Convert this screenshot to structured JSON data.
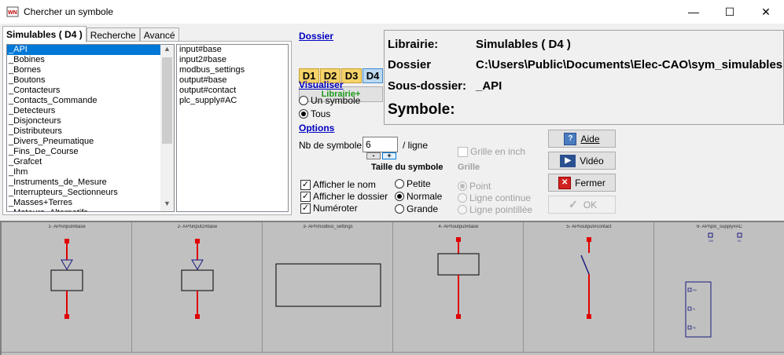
{
  "window": {
    "title": "Chercher un symbole",
    "minimize_glyph": "—",
    "maximize_glyph": "☐",
    "close_glyph": "✕"
  },
  "tabs": [
    "Simulables ( D4 )",
    "Recherche",
    "Avancé"
  ],
  "categories": {
    "selected": "_API",
    "items": [
      "_API",
      "_Bobines",
      "_Bornes",
      "_Boutons",
      "_Contacteurs",
      "_Contacts_Commande",
      "_Detecteurs",
      "_Disjoncteurs",
      "_Distributeurs",
      "_Divers_Pneumatique",
      "_Fins_De_Course",
      "_Grafcet",
      "_Ihm",
      "_Instruments_de_Mesure",
      "_Interrupteurs_Sectionneurs",
      "_Masses+Terres",
      "_Moteurs_Alternatifs"
    ]
  },
  "symbols": [
    "input#base",
    "input2#base",
    "modbus_settings",
    "output#base",
    "output#contact",
    "plc_supply#AC"
  ],
  "dossier": {
    "heading": "Dossier",
    "buttons": [
      "D1",
      "D2",
      "D3",
      "D4"
    ],
    "active": "D4",
    "library_button": "Librairie+"
  },
  "visualiser": {
    "heading": "Visualiser",
    "options": [
      "Un symbole",
      "Tous"
    ],
    "selected": "Tous"
  },
  "options": {
    "heading": "Options",
    "count_label": "Nb de symbole :",
    "count_value": "6",
    "per_line": "/ ligne",
    "minus": "-",
    "plus": "+",
    "checkboxes": [
      {
        "label": "Afficher le nom",
        "checked": true
      },
      {
        "label": "Afficher le dossier",
        "checked": true
      },
      {
        "label": "Numéroter",
        "checked": true
      }
    ],
    "size_heading": "Taille du symbole",
    "sizes": [
      "Petite",
      "Normale",
      "Grande"
    ],
    "size_selected": "Normale"
  },
  "grille": {
    "inch_label": "Grille en inch",
    "heading": "Grille",
    "options": [
      "Point",
      "Ligne continue",
      "Ligne pointillée"
    ],
    "selected": "Point"
  },
  "info": {
    "librairie_label": "Librairie:",
    "librairie_value": "Simulables ( D4 )",
    "dossier_label": "Dossier",
    "dossier_value": "C:\\Users\\Public\\Documents\\Elec-CAO\\sym_simulables",
    "sous_dossier_label": "Sous-dossier:",
    "sous_dossier_value": "_API",
    "symbole_label": "Symbole:"
  },
  "buttons": {
    "aide": "Aide",
    "video": "Vidéo",
    "fermer": "Fermer",
    "ok": "OK"
  },
  "preview": [
    {
      "title": "1- API\\input#base",
      "kind": "input"
    },
    {
      "title": "2- API\\input2#base",
      "kind": "input"
    },
    {
      "title": "3- API\\modbus_settings",
      "kind": "modbus"
    },
    {
      "title": "4- API\\output#base",
      "kind": "output"
    },
    {
      "title": "5- API\\output#contact",
      "kind": "contact"
    },
    {
      "title": "6- API\\plc_supply#AC",
      "kind": "supply"
    }
  ],
  "supply_labels": [
    "24V",
    "0V",
    "PE+",
    "M-",
    "PE"
  ],
  "colors": {
    "selection": "#0078d7",
    "link_blue": "#0000c0",
    "library_green": "#1a9a1a",
    "wire_red": "#e00000",
    "preview_bg": "#c0c0c0",
    "supply_blue": "#1a1a80"
  }
}
